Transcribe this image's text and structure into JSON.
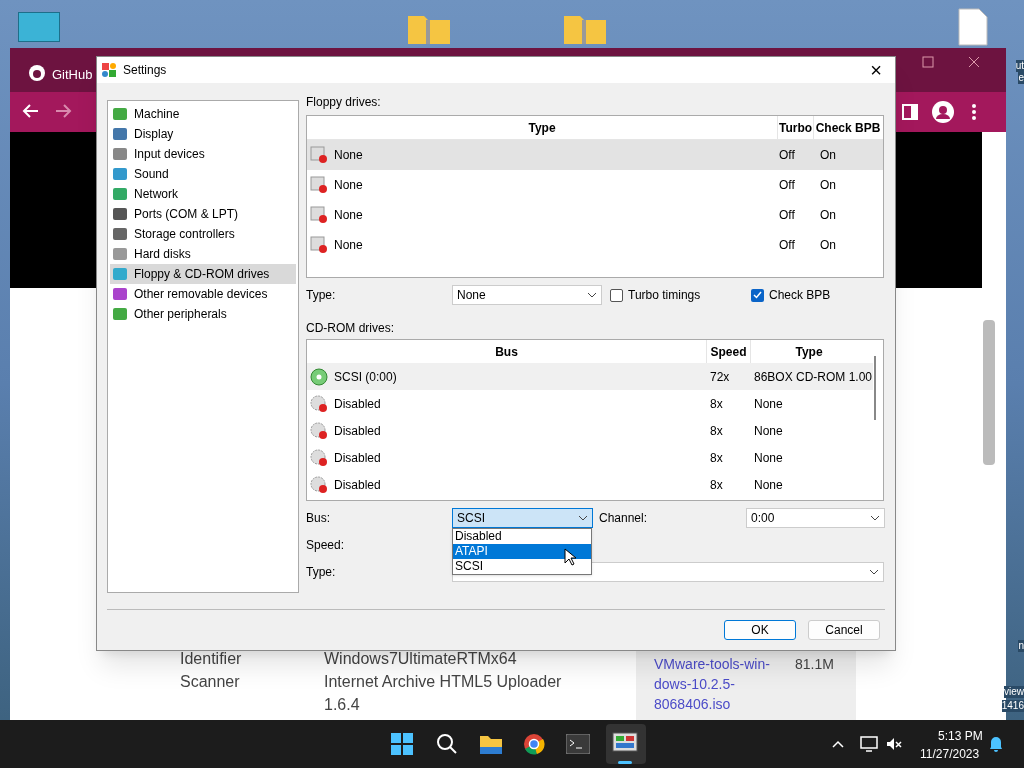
{
  "desktop": {
    "edge_labels": [
      "ut",
      "e",
      "n",
      "view",
      "1416"
    ]
  },
  "browser": {
    "tab_title": "GitHub",
    "page": {
      "rows": [
        {
          "label": "Identifier",
          "value": "Windows7UltimateRTMx64"
        },
        {
          "label": "Scanner",
          "value": "Internet Archive HTML5 Uploader 1.6.4"
        }
      ],
      "download": {
        "link": "VMware-tools-win-dows-10.2.5-8068406.iso",
        "size": "81.1M"
      }
    }
  },
  "dialog": {
    "title": "Settings",
    "close": "×",
    "categories": [
      {
        "label": "Machine",
        "selected": false
      },
      {
        "label": "Display",
        "selected": false
      },
      {
        "label": "Input devices",
        "selected": false
      },
      {
        "label": "Sound",
        "selected": false
      },
      {
        "label": "Network",
        "selected": false
      },
      {
        "label": "Ports (COM & LPT)",
        "selected": false
      },
      {
        "label": "Storage controllers",
        "selected": false
      },
      {
        "label": "Hard disks",
        "selected": false
      },
      {
        "label": "Floppy & CD-ROM drives",
        "selected": true
      },
      {
        "label": "Other removable devices",
        "selected": false
      },
      {
        "label": "Other peripherals",
        "selected": false
      }
    ],
    "floppy": {
      "label": "Floppy drives:",
      "columns": [
        "Type",
        "Turbo",
        "Check BPB"
      ],
      "rows": [
        {
          "type": "None",
          "turbo": "Off",
          "check_bpb": "On",
          "selected": true
        },
        {
          "type": "None",
          "turbo": "Off",
          "check_bpb": "On",
          "selected": false
        },
        {
          "type": "None",
          "turbo": "Off",
          "check_bpb": "On",
          "selected": false
        },
        {
          "type": "None",
          "turbo": "Off",
          "check_bpb": "On",
          "selected": false
        }
      ],
      "type_label": "Type:",
      "type_value": "None",
      "checkboxes": [
        {
          "label": "Turbo timings",
          "checked": false
        },
        {
          "label": "Check BPB",
          "checked": true
        }
      ]
    },
    "cdrom": {
      "label": "CD-ROM drives:",
      "columns": [
        "Bus",
        "Speed",
        "Type"
      ],
      "rows": [
        {
          "bus": "SCSI (0:00)",
          "speed": "72x",
          "type": "86BOX CD-ROM 1.00",
          "enabled": true,
          "selected": true
        },
        {
          "bus": "Disabled",
          "speed": "8x",
          "type": "None",
          "enabled": false,
          "selected": false
        },
        {
          "bus": "Disabled",
          "speed": "8x",
          "type": "None",
          "enabled": false,
          "selected": false
        },
        {
          "bus": "Disabled",
          "speed": "8x",
          "type": "None",
          "enabled": false,
          "selected": false
        },
        {
          "bus": "Disabled",
          "speed": "8x",
          "type": "None",
          "enabled": false,
          "selected": false
        }
      ],
      "bus_label": "Bus:",
      "bus_value": "SCSI",
      "bus_options": [
        {
          "label": "Disabled",
          "selected": false
        },
        {
          "label": "ATAPI",
          "selected": true
        },
        {
          "label": "SCSI",
          "selected": false
        }
      ],
      "channel_label": "Channel:",
      "channel_value": "0:00",
      "speed_label": "Speed:",
      "type_label": "Type:"
    },
    "buttons": [
      "OK",
      "Cancel"
    ]
  },
  "taskbar": {
    "time": "5:13 PM",
    "date": "11/27/2023"
  }
}
